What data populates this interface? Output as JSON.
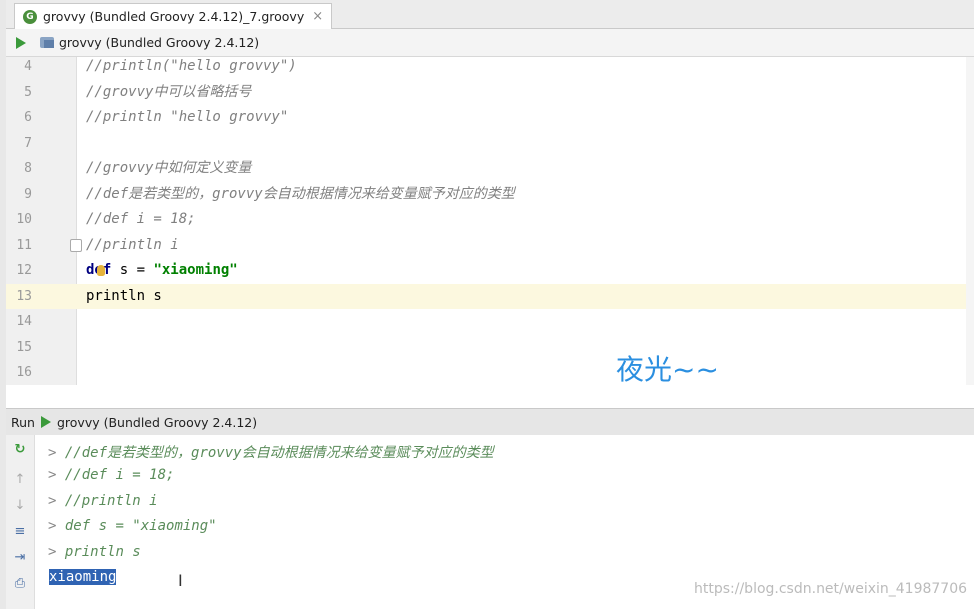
{
  "tab": {
    "icon": "G",
    "title": "grovvy (Bundled Groovy 2.4.12)_7.groovy",
    "close": "×"
  },
  "toolbar": {
    "module": "grovvy (Bundled Groovy 2.4.12)"
  },
  "editor": {
    "lines": [
      {
        "num": "4",
        "text": "//println(\"hello grovvy\")"
      },
      {
        "num": "5",
        "text": "//grovvy中可以省略括号"
      },
      {
        "num": "6",
        "text": "//println \"hello grovvy\""
      },
      {
        "num": "7",
        "text": ""
      },
      {
        "num": "8",
        "text": "//grovvy中如何定义变量"
      },
      {
        "num": "9",
        "text": "//def是若类型的，grovvy会自动根据情况来给变量赋予对应的类型"
      },
      {
        "num": "10",
        "text": "//def i = 18;"
      },
      {
        "num": "11",
        "text": "//println i"
      },
      {
        "num": "12",
        "kw": "def",
        "plain": " s = ",
        "str": "\"xiaoming\""
      },
      {
        "num": "13",
        "text": "println s"
      },
      {
        "num": "14",
        "text": ""
      },
      {
        "num": "15",
        "text": ""
      },
      {
        "num": "16",
        "text": ""
      }
    ]
  },
  "watermark_title": "夜光~~",
  "run": {
    "label": "Run",
    "config": "grovvy (Bundled Groovy 2.4.12)"
  },
  "console": {
    "prompt": ">",
    "lines": [
      "//def是若类型的，grovvy会自动根据情况来给变量赋予对应的类型",
      "//def i = 18;",
      "//println i",
      "def s = \"xiaoming\"",
      "println s"
    ],
    "output": "xiaoming"
  },
  "csdn_watermark": "https://blog.csdn.net/weixin_41987706"
}
